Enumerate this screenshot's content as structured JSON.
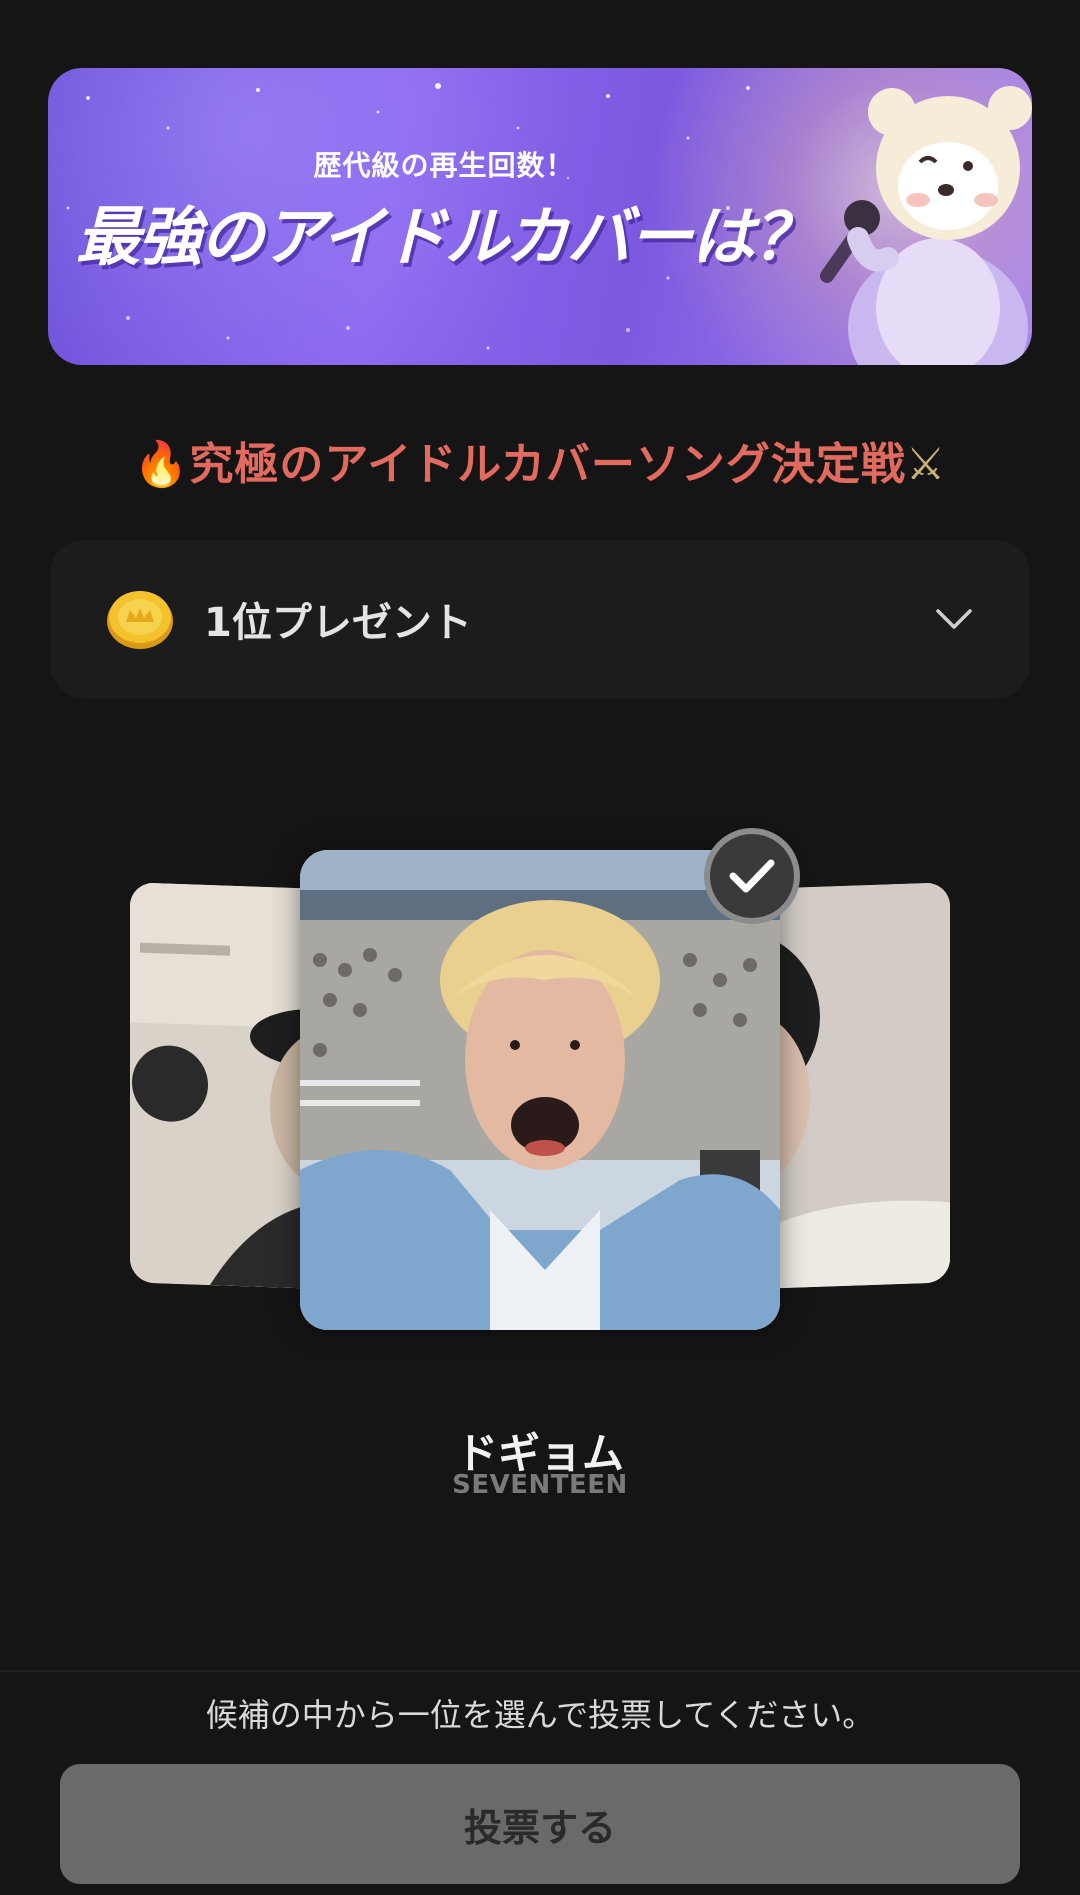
{
  "banner": {
    "subtitle": "歴代級の再生回数！",
    "title": "最強のアイドルカバーは？"
  },
  "headline": {
    "emoji_left": "🔥",
    "text": "究極のアイドルカバーソング決定戦",
    "emoji_right": "⚔"
  },
  "prize": {
    "label": "1位プレゼント",
    "icon": "coin-icon",
    "toggle_icon": "chevron-down-icon"
  },
  "candidate": {
    "name": "ドギョム",
    "group": "SEVENTEEN",
    "selected": true
  },
  "footer": {
    "instruction": "候補の中から一位を選んで投票してください。",
    "vote_label": "投票する"
  },
  "colors": {
    "background": "#151515",
    "headline": "#e36a5e",
    "vote_button": "#6a6a6a"
  }
}
